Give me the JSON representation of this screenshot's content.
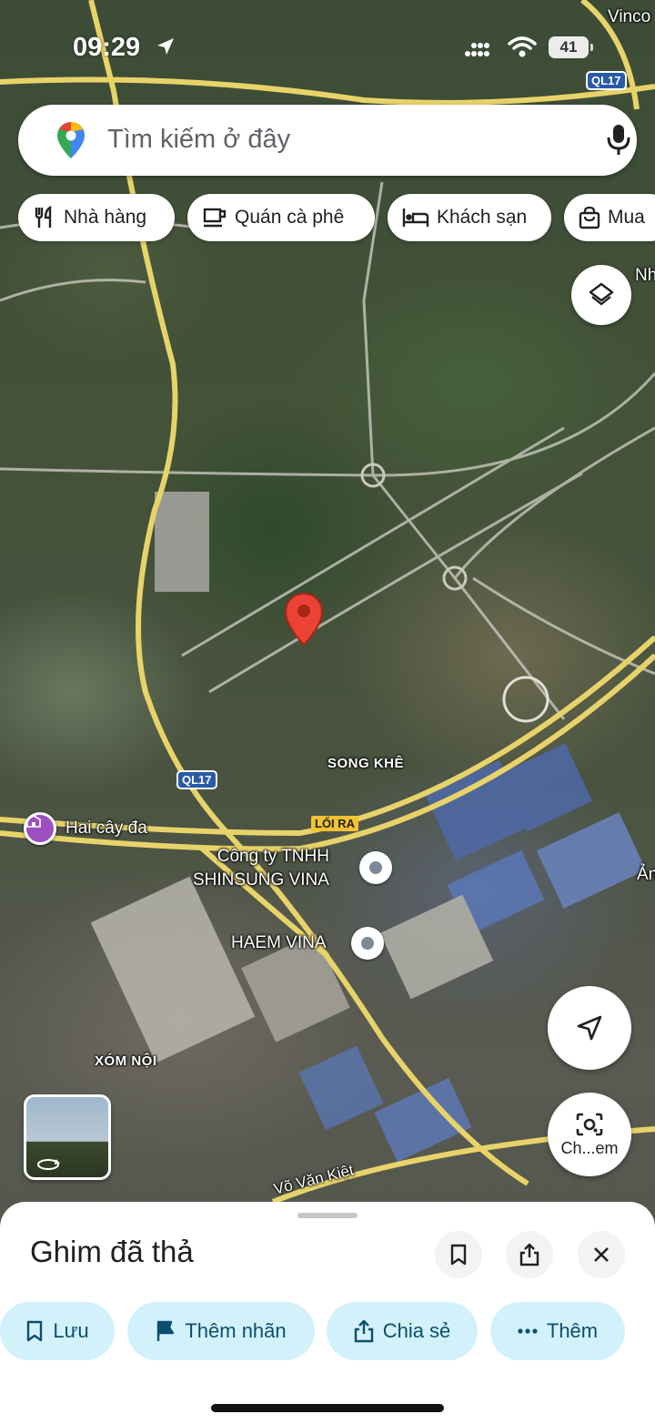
{
  "status_bar": {
    "time": "09:29",
    "battery": "41"
  },
  "search": {
    "placeholder": "Tìm kiếm ở đây"
  },
  "chips": [
    {
      "label": "Nhà hàng",
      "icon": "restaurant-icon"
    },
    {
      "label": "Quán cà phê",
      "icon": "coffee-icon"
    },
    {
      "label": "Khách sạn",
      "icon": "hotel-icon"
    },
    {
      "label": "Mua",
      "icon": "shopping-bag-icon"
    }
  ],
  "map": {
    "labels": {
      "vinco": "Vinco",
      "nh": "Nh",
      "song_khe": "SONG KHÊ",
      "hai_cay_da": "Hai cây đa",
      "shinsung": "Công ty TNHH\nSHINSUNG VINA",
      "haem": "HAEM VINA",
      "xom_noi": "XÓM NỘI",
      "vo_van_kiet": "Võ Văn Kiệt",
      "an": "Ản"
    },
    "shields": {
      "ql17_top": "QL17",
      "ql17_mid": "QL17"
    },
    "exit_tag": "LỐI RA"
  },
  "lens": {
    "label": "Ch...em"
  },
  "sheet": {
    "title": "Ghim đã thả",
    "actions": [
      {
        "label": "Lưu",
        "icon": "bookmark-icon"
      },
      {
        "label": "Thêm nhãn",
        "icon": "flag-icon"
      },
      {
        "label": "Chia sẻ",
        "icon": "share-icon"
      },
      {
        "label": "Thêm",
        "icon": "more-icon"
      }
    ]
  },
  "colors": {
    "pin_red": "#ea4335",
    "action_pill_bg": "#d3f1fb",
    "action_pill_text": "#0b4f6c",
    "road_yellow": "#e8d36a",
    "shield_blue": "#2a5aa8"
  }
}
